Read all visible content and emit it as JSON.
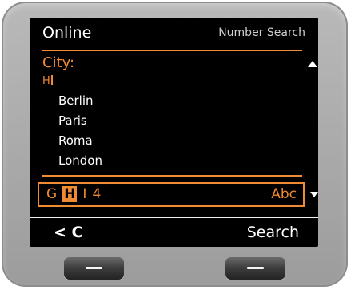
{
  "header": {
    "title": "Online",
    "subtitle": "Number Search"
  },
  "search": {
    "field_label": "City:",
    "input_value": "H"
  },
  "results": {
    "items": [
      "Berlin",
      "Paris",
      "Roma",
      "London"
    ]
  },
  "keypad": {
    "keys": [
      "G",
      "H",
      "I",
      "4"
    ],
    "active_key": "H",
    "mode": "Abc"
  },
  "softkeys": {
    "left_label": "< C",
    "right_label": "Search"
  },
  "icons": {
    "scroll_up": "triangle-up-icon",
    "scroll_down": "triangle-down-icon"
  },
  "colors": {
    "accent": "#f08a33",
    "screen_bg": "#000000",
    "text": "#ffffff"
  }
}
